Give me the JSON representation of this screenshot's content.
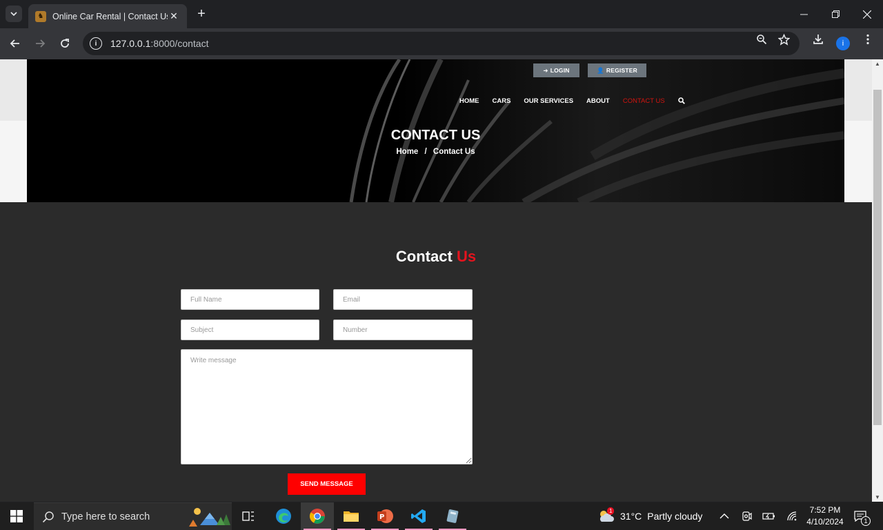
{
  "browser": {
    "tab_title": "Online Car Rental | Contact Us",
    "url_host": "127.0.0.1",
    "url_path": ":8000/contact",
    "profile_initial": "i"
  },
  "site": {
    "auth": {
      "login": "LOGIN",
      "register": "REGISTER"
    },
    "nav": [
      "HOME",
      "CARS",
      "OUR SERVICES",
      "ABOUT",
      "CONTACT US"
    ],
    "active_nav": "CONTACT US",
    "hero_title": "CONTACT US",
    "breadcrumb": {
      "home": "Home",
      "sep": "/",
      "current": "Contact Us"
    },
    "section_title_white": "Contact",
    "section_title_red": "Us",
    "form": {
      "full_name_placeholder": "Full Name",
      "email_placeholder": "Email",
      "subject_placeholder": "Subject",
      "number_placeholder": "Number",
      "message_placeholder": "Write message",
      "submit_label": "SEND MESSAGE"
    },
    "colors": {
      "accent_red": "#e3141e",
      "button_red": "#ff0000",
      "page_bg": "#2b2b2b"
    }
  },
  "taskbar": {
    "search_placeholder": "Type here to search",
    "weather_temp": "31°C",
    "weather_text": "Partly cloudy",
    "weather_badge": "1",
    "time": "7:52 PM",
    "date": "4/10/2024",
    "notification_count": "1"
  }
}
